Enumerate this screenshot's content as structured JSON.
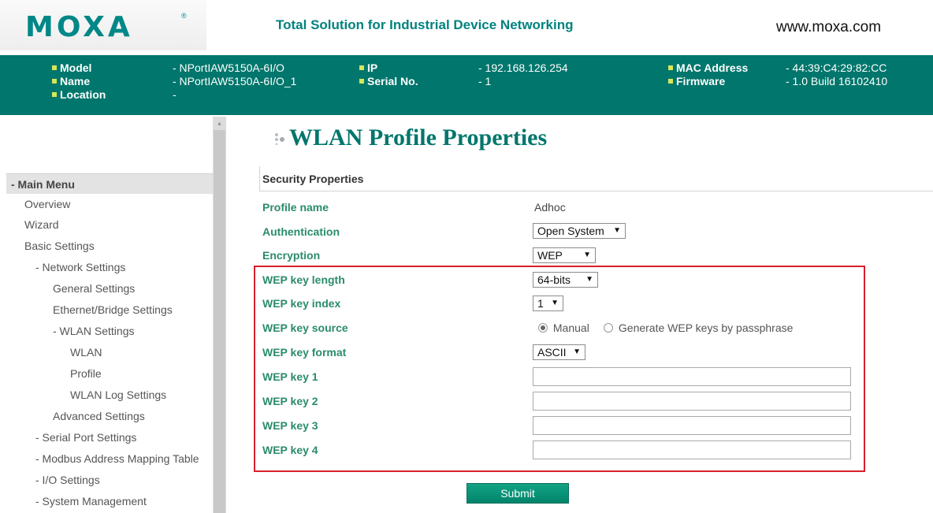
{
  "header": {
    "logo_text": "MOXA",
    "logo_mark": "®",
    "tagline": "Total Solution for Industrial Device Networking",
    "website": "www.moxa.com"
  },
  "info_bar": {
    "model_label": "Model",
    "model_value": "- NPortIAW5150A-6I/O",
    "name_label": "Name",
    "name_value": "- NPortIAW5150A-6I/O_1",
    "location_label": "Location",
    "location_value": "-",
    "ip_label": "IP",
    "ip_value": "- 192.168.126.254",
    "serial_label": "Serial No.",
    "serial_value": "- 1",
    "mac_label": "MAC Address",
    "mac_value": "- 44:39:C4:29:82:CC",
    "firmware_label": "Firmware",
    "firmware_value": "- 1.0 Build 16102410"
  },
  "sidebar": {
    "header": "- Main Menu",
    "items": [
      "Overview",
      "Wizard",
      "Basic Settings",
      "- Network Settings",
      "General Settings",
      "Ethernet/Bridge Settings",
      "- WLAN Settings",
      "WLAN",
      "Profile",
      "WLAN Log Settings",
      "Advanced Settings",
      "- Serial Port Settings",
      "- Modbus Address Mapping Table",
      "- I/O Settings",
      "- System Management"
    ]
  },
  "main": {
    "title": "WLAN Profile Properties",
    "section_title": "Security Properties",
    "profile_name_label": "Profile name",
    "profile_name_value": "Adhoc",
    "authentication_label": "Authentication",
    "authentication_value": "Open System",
    "encryption_label": "Encryption",
    "encryption_value": "WEP",
    "wep_key_length_label": "WEP key length",
    "wep_key_length_value": "64-bits",
    "wep_key_index_label": "WEP key index",
    "wep_key_index_value": "1",
    "wep_key_source_label": "WEP key source",
    "wep_key_source_options": [
      "Manual",
      "Generate WEP keys by passphrase"
    ],
    "wep_key_source_selected": "Manual",
    "wep_key_format_label": "WEP key format",
    "wep_key_format_value": "ASCII",
    "wep_key_1_label": "WEP key 1",
    "wep_key_2_label": "WEP key 2",
    "wep_key_3_label": "WEP key 3",
    "wep_key_4_label": "WEP key 4",
    "wep_key_1_value": "",
    "wep_key_2_value": "",
    "wep_key_3_value": "",
    "wep_key_4_value": "",
    "submit_label": "Submit",
    "dropdown_arrow": "▼"
  },
  "colors": {
    "brand": "#008787",
    "info_bar_bg": "#00766c",
    "field_label": "#2a8c6a",
    "highlight": "#d6202a",
    "submit_bg": "#00846a"
  },
  "icons": {
    "title_bullet": "dots-icon",
    "scroll_up": "scroll-up-icon"
  }
}
